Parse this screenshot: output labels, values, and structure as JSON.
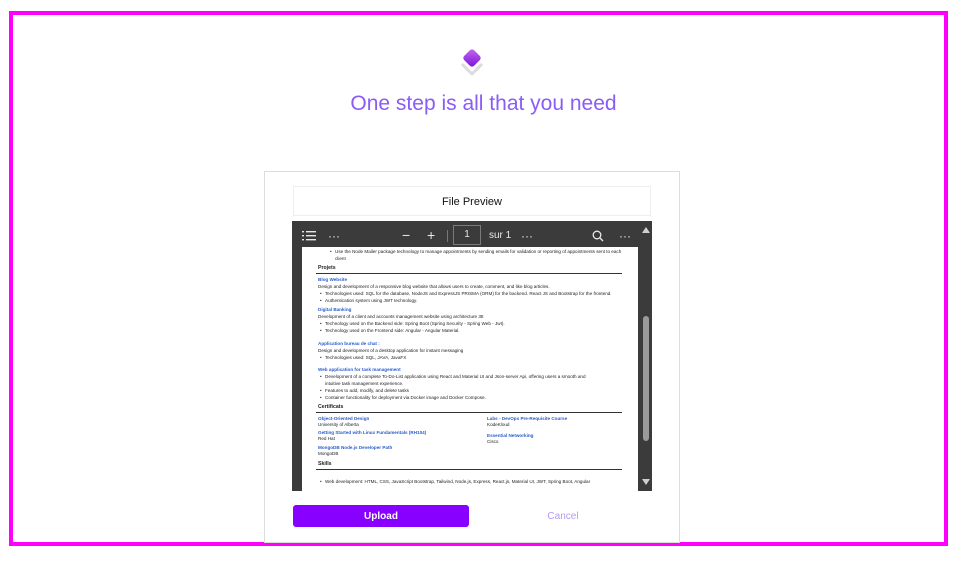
{
  "headline": "One step is all that you need",
  "colors": {
    "frame": "#ff00ff",
    "accent": "#8a5cf5",
    "button": "#8800ff",
    "cancel": "#b59cf0"
  },
  "preview": {
    "title": "File Preview",
    "toolbar": {
      "contents_icon": "list-icon",
      "more": "···",
      "zoom_out": "−",
      "zoom_in": "+",
      "page_number": "1",
      "page_total": "sur 1",
      "more2": "···",
      "search_icon": "search-icon",
      "more3": "···"
    }
  },
  "document": {
    "lines": {
      "l0": "Use the Node Mailer package technology to manage appointments by sending emails for validation or reporting of appointments sent to each",
      "l1": "client",
      "projects": "Projets",
      "p1_title": "Blog Website",
      "p1_desc": "Design and development of a responsive blog website that allows users to create, comment, and like blog articles.",
      "p1_b1": "Technologies used: SQL for the database, NodeJS and ExpressJS PRISMA (ORM) for the backend. React JS and Bootstrap for the frontend.",
      "p1_b2": "Authentication system using JWT technology.",
      "p2_title": "Digital Banking",
      "p2_desc": "Development of a client and accounts management website using architecture 3tt",
      "p2_b1": "Technology used on the Backend side: Spring Boot (Spring Security - Spring Web - Jwt).",
      "p2_b2": "Technology used on the Frontend side: Angular - Angular Material.",
      "p3_title": "Application bureau de chat :",
      "p3_desc": "Design and development of a desktop application for instant messaging",
      "p3_b1": "Technologies used: SQL, JAVA, JavaFX",
      "p4_title": "Web application for task management",
      "p4_b1": "Development of a complete To-Do-List application using React and Material UI and Json-server Api, offering users a smooth and",
      "p4_b1b": "intuitive task management experience.",
      "p4_b2": "Features to add, modify, and delete tasks",
      "p4_b3": "Container functionality for deployment via Docker image and Docker Compose.",
      "certificates": "Certificats",
      "c1_title": "Object-Oriented Design",
      "c1_org": "University of Alberta",
      "c2_title": "Labs - DevOps Pre-Requisite Course",
      "c2_org": "KodeKloud",
      "c3_title": "Getting Started with Linux Fundamentals (RH104)",
      "c3_org": "Red Hat",
      "c4_title": "Essential Networking",
      "c4_org": "Cisco",
      "c5_title": "MongoDB Node.js Developer Path",
      "c5_org": "MongoDB",
      "skills": "Skills",
      "s1": "Web development: HTML, CSS, JavaScript Bootstrap, Tailwind, Node.js, Express, React.js, Material UI, JWT, Spring Boot, Angular"
    }
  },
  "actions": {
    "upload": "Upload",
    "cancel": "Cancel"
  }
}
